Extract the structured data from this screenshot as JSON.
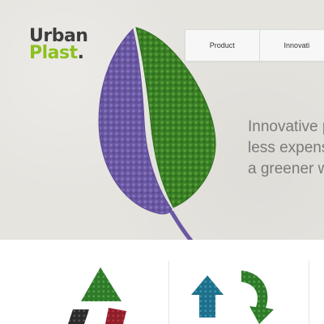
{
  "logo": {
    "line1": "Urban",
    "line2": "Plast",
    "dot": "."
  },
  "nav": {
    "items": [
      {
        "label": "Product"
      },
      {
        "label": "Innovati"
      }
    ]
  },
  "hero": {
    "tagline": [
      "Innovative p",
      "less expens",
      "a greener w"
    ]
  },
  "colors": {
    "brand_green": "#8cc01f",
    "leaf_green": "#3f8a2a",
    "leaf_purple": "#6e5aa6",
    "text_gray": "#7a7a7a"
  },
  "icons": [
    "leaf-icon",
    "triangle-pellets-icon",
    "recycle-arrows-icon"
  ]
}
